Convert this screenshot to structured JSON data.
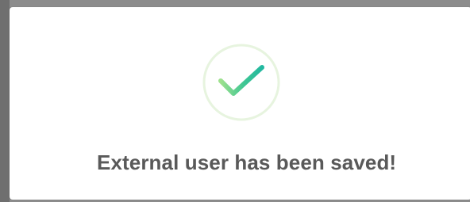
{
  "dialog": {
    "icon": "check-circle-icon",
    "message": "External user has been saved!",
    "colors": {
      "accent": "#22b8a0",
      "accent_soft": "#9ee18d",
      "ring": "#e7f4df",
      "text": "#595959"
    }
  }
}
